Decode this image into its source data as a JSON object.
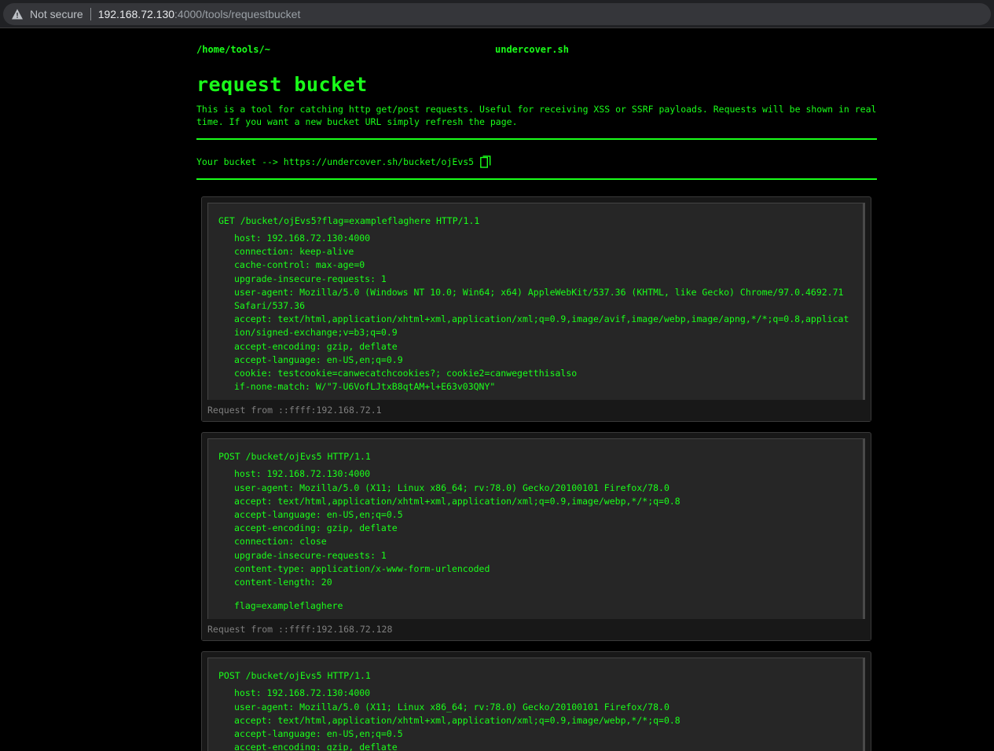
{
  "browser": {
    "security_label": "Not secure",
    "url_host": "192.168.72.130",
    "url_rest": ":4000/tools/requestbucket"
  },
  "nav": {
    "home": "/home/tools/~",
    "brand": "undercover.sh"
  },
  "title": "request bucket",
  "description": "This is a tool for catching http get/post requests. Useful for receiving XSS or SSRF payloads. Requests will be shown in real time. If you want a new bucket URL simply refresh the page.",
  "bucket": {
    "label": "Your bucket --> https://undercover.sh/bucket/ojEvs5",
    "copy_icon": "copy-icon"
  },
  "requests": [
    {
      "request_line": "GET /bucket/ojEvs5?flag=exampleflaghere HTTP/1.1",
      "headers": [
        "host: 192.168.72.130:4000",
        "connection: keep-alive",
        "cache-control: max-age=0",
        "upgrade-insecure-requests: 1",
        "user-agent: Mozilla/5.0 (Windows NT 10.0; Win64; x64) AppleWebKit/537.36 (KHTML, like Gecko) Chrome/97.0.4692.71 Safari/537.36",
        "accept: text/html,application/xhtml+xml,application/xml;q=0.9,image/avif,image/webp,image/apng,*/*;q=0.8,application/signed-exchange;v=b3;q=0.9",
        "accept-encoding: gzip, deflate",
        "accept-language: en-US,en;q=0.9",
        "cookie: testcookie=canwecatchcookies?; cookie2=canwegetthisalso",
        "if-none-match: W/\"7-U6VofLJtxB8qtAM+l+E63v03QNY\""
      ],
      "body": "",
      "from": "Request from ::ffff:192.168.72.1"
    },
    {
      "request_line": "POST /bucket/ojEvs5 HTTP/1.1",
      "headers": [
        "host: 192.168.72.130:4000",
        "user-agent: Mozilla/5.0 (X11; Linux x86_64; rv:78.0) Gecko/20100101 Firefox/78.0",
        "accept: text/html,application/xhtml+xml,application/xml;q=0.9,image/webp,*/*;q=0.8",
        "accept-language: en-US,en;q=0.5",
        "accept-encoding: gzip, deflate",
        "connection: close",
        "upgrade-insecure-requests: 1",
        "content-type: application/x-www-form-urlencoded",
        "content-length: 20"
      ],
      "body": "flag=exampleflaghere",
      "from": "Request from ::ffff:192.168.72.128"
    },
    {
      "request_line": "POST /bucket/ojEvs5 HTTP/1.1",
      "headers": [
        "host: 192.168.72.130:4000",
        "user-agent: Mozilla/5.0 (X11; Linux x86_64; rv:78.0) Gecko/20100101 Firefox/78.0",
        "accept: text/html,application/xhtml+xml,application/xml;q=0.9,image/webp,*/*;q=0.8",
        "accept-language: en-US,en;q=0.5",
        "accept-encoding: gzip, deflate"
      ],
      "body": "",
      "from": ""
    }
  ]
}
